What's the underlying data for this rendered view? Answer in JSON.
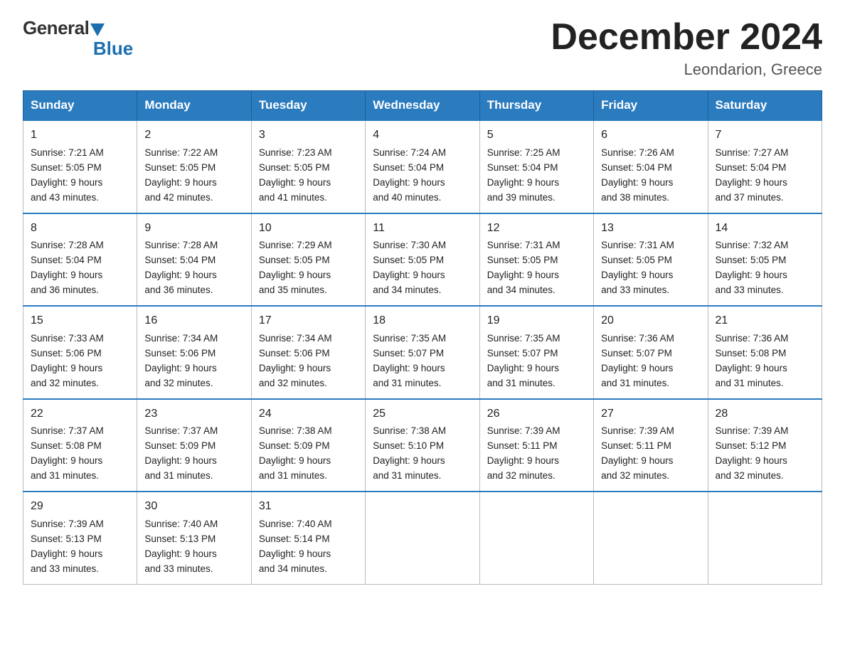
{
  "logo": {
    "general": "General",
    "blue": "Blue"
  },
  "title": {
    "month_year": "December 2024",
    "location": "Leondarion, Greece"
  },
  "days_of_week": [
    "Sunday",
    "Monday",
    "Tuesday",
    "Wednesday",
    "Thursday",
    "Friday",
    "Saturday"
  ],
  "weeks": [
    [
      {
        "day": "1",
        "sunrise": "7:21 AM",
        "sunset": "5:05 PM",
        "daylight": "9 hours and 43 minutes."
      },
      {
        "day": "2",
        "sunrise": "7:22 AM",
        "sunset": "5:05 PM",
        "daylight": "9 hours and 42 minutes."
      },
      {
        "day": "3",
        "sunrise": "7:23 AM",
        "sunset": "5:05 PM",
        "daylight": "9 hours and 41 minutes."
      },
      {
        "day": "4",
        "sunrise": "7:24 AM",
        "sunset": "5:04 PM",
        "daylight": "9 hours and 40 minutes."
      },
      {
        "day": "5",
        "sunrise": "7:25 AM",
        "sunset": "5:04 PM",
        "daylight": "9 hours and 39 minutes."
      },
      {
        "day": "6",
        "sunrise": "7:26 AM",
        "sunset": "5:04 PM",
        "daylight": "9 hours and 38 minutes."
      },
      {
        "day": "7",
        "sunrise": "7:27 AM",
        "sunset": "5:04 PM",
        "daylight": "9 hours and 37 minutes."
      }
    ],
    [
      {
        "day": "8",
        "sunrise": "7:28 AM",
        "sunset": "5:04 PM",
        "daylight": "9 hours and 36 minutes."
      },
      {
        "day": "9",
        "sunrise": "7:28 AM",
        "sunset": "5:04 PM",
        "daylight": "9 hours and 36 minutes."
      },
      {
        "day": "10",
        "sunrise": "7:29 AM",
        "sunset": "5:05 PM",
        "daylight": "9 hours and 35 minutes."
      },
      {
        "day": "11",
        "sunrise": "7:30 AM",
        "sunset": "5:05 PM",
        "daylight": "9 hours and 34 minutes."
      },
      {
        "day": "12",
        "sunrise": "7:31 AM",
        "sunset": "5:05 PM",
        "daylight": "9 hours and 34 minutes."
      },
      {
        "day": "13",
        "sunrise": "7:31 AM",
        "sunset": "5:05 PM",
        "daylight": "9 hours and 33 minutes."
      },
      {
        "day": "14",
        "sunrise": "7:32 AM",
        "sunset": "5:05 PM",
        "daylight": "9 hours and 33 minutes."
      }
    ],
    [
      {
        "day": "15",
        "sunrise": "7:33 AM",
        "sunset": "5:06 PM",
        "daylight": "9 hours and 32 minutes."
      },
      {
        "day": "16",
        "sunrise": "7:34 AM",
        "sunset": "5:06 PM",
        "daylight": "9 hours and 32 minutes."
      },
      {
        "day": "17",
        "sunrise": "7:34 AM",
        "sunset": "5:06 PM",
        "daylight": "9 hours and 32 minutes."
      },
      {
        "day": "18",
        "sunrise": "7:35 AM",
        "sunset": "5:07 PM",
        "daylight": "9 hours and 31 minutes."
      },
      {
        "day": "19",
        "sunrise": "7:35 AM",
        "sunset": "5:07 PM",
        "daylight": "9 hours and 31 minutes."
      },
      {
        "day": "20",
        "sunrise": "7:36 AM",
        "sunset": "5:07 PM",
        "daylight": "9 hours and 31 minutes."
      },
      {
        "day": "21",
        "sunrise": "7:36 AM",
        "sunset": "5:08 PM",
        "daylight": "9 hours and 31 minutes."
      }
    ],
    [
      {
        "day": "22",
        "sunrise": "7:37 AM",
        "sunset": "5:08 PM",
        "daylight": "9 hours and 31 minutes."
      },
      {
        "day": "23",
        "sunrise": "7:37 AM",
        "sunset": "5:09 PM",
        "daylight": "9 hours and 31 minutes."
      },
      {
        "day": "24",
        "sunrise": "7:38 AM",
        "sunset": "5:09 PM",
        "daylight": "9 hours and 31 minutes."
      },
      {
        "day": "25",
        "sunrise": "7:38 AM",
        "sunset": "5:10 PM",
        "daylight": "9 hours and 31 minutes."
      },
      {
        "day": "26",
        "sunrise": "7:39 AM",
        "sunset": "5:11 PM",
        "daylight": "9 hours and 32 minutes."
      },
      {
        "day": "27",
        "sunrise": "7:39 AM",
        "sunset": "5:11 PM",
        "daylight": "9 hours and 32 minutes."
      },
      {
        "day": "28",
        "sunrise": "7:39 AM",
        "sunset": "5:12 PM",
        "daylight": "9 hours and 32 minutes."
      }
    ],
    [
      {
        "day": "29",
        "sunrise": "7:39 AM",
        "sunset": "5:13 PM",
        "daylight": "9 hours and 33 minutes."
      },
      {
        "day": "30",
        "sunrise": "7:40 AM",
        "sunset": "5:13 PM",
        "daylight": "9 hours and 33 minutes."
      },
      {
        "day": "31",
        "sunrise": "7:40 AM",
        "sunset": "5:14 PM",
        "daylight": "9 hours and 34 minutes."
      },
      null,
      null,
      null,
      null
    ]
  ],
  "labels": {
    "sunrise": "Sunrise:",
    "sunset": "Sunset:",
    "daylight": "Daylight:"
  }
}
